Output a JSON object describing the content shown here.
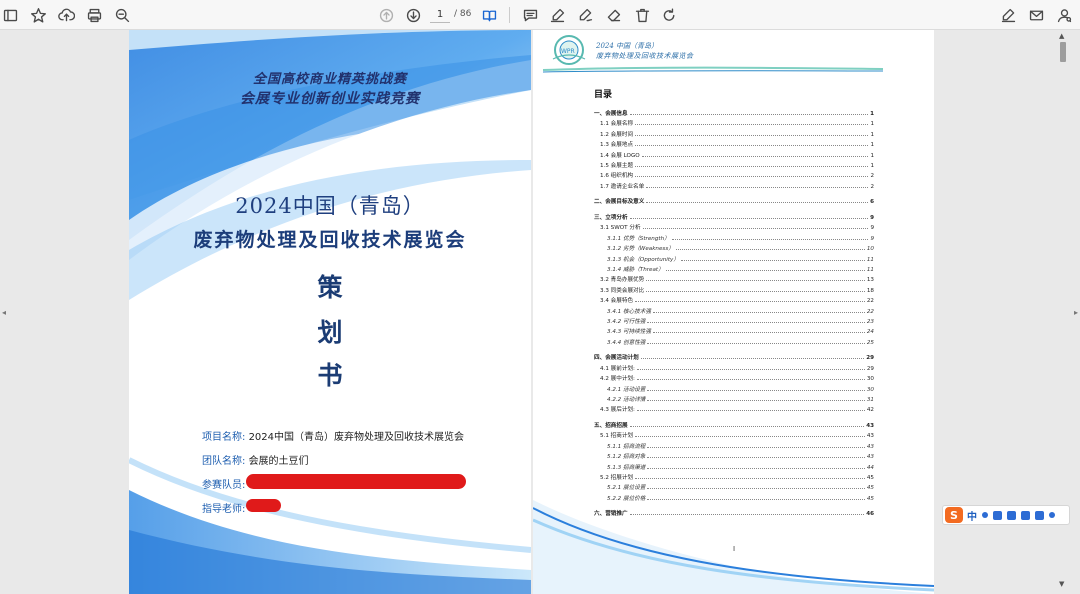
{
  "toolbar": {
    "current_page": "1",
    "total_pages": "/ 86"
  },
  "cover": {
    "header_line1": "全国高校商业精英挑战赛",
    "header_line2": "会展专业创新创业实践竞赛",
    "title_line1": "2024中国（青岛）",
    "title_line2": "废弃物处理及回收技术展览会",
    "big_chars": [
      "策",
      "划",
      "书"
    ],
    "fields": [
      {
        "label": "项目名称:",
        "value": "2024中国（青岛）废弃物处理及回收技术展览会"
      },
      {
        "label": "团队名称:",
        "value": "会展的土豆们"
      },
      {
        "label": "参赛队员:",
        "value": ""
      },
      {
        "label": "指导老师:",
        "value": ""
      }
    ],
    "colors": {
      "accent_blue": "#1f5fb0",
      "redaction": "#e01a1a"
    }
  },
  "toc": {
    "header_line1": "2024 中国（青岛）",
    "header_line2": "废弃物处理及回收技术展览会",
    "title": "目录",
    "entries": [
      {
        "level": 1,
        "text": "一、会展信息",
        "page": "1"
      },
      {
        "level": 2,
        "text": "1.1 会展名称",
        "page": "1"
      },
      {
        "level": 2,
        "text": "1.2 会展时间",
        "page": "1"
      },
      {
        "level": 2,
        "text": "1.3 会展地点",
        "page": "1"
      },
      {
        "level": 2,
        "text": "1.4 会展 LOGO",
        "page": "1"
      },
      {
        "level": 2,
        "text": "1.5 会展主题",
        "page": "1"
      },
      {
        "level": 2,
        "text": "1.6 组织机构",
        "page": "2"
      },
      {
        "level": 2,
        "text": "1.7 邀请企业名单",
        "page": "2"
      },
      {
        "level": 1,
        "text": "二、会展目标及意义",
        "page": "6"
      },
      {
        "level": 1,
        "text": "三、立项分析",
        "page": "9"
      },
      {
        "level": 2,
        "text": "3.1 SWOT 分析",
        "page": "9"
      },
      {
        "level": 3,
        "text": "3.1.1 优势（Strength）",
        "page": "9"
      },
      {
        "level": 3,
        "text": "3.1.2 劣势（Weakness）",
        "page": "10"
      },
      {
        "level": 3,
        "text": "3.1.3 机会（Opportunity）",
        "page": "11"
      },
      {
        "level": 3,
        "text": "3.1.4 威胁（Threat）",
        "page": "11"
      },
      {
        "level": 2,
        "text": "3.2 青岛办展优势",
        "page": "13"
      },
      {
        "level": 2,
        "text": "3.3 同类会展对比",
        "page": "18"
      },
      {
        "level": 2,
        "text": "3.4 会展特色",
        "page": "22"
      },
      {
        "level": 3,
        "text": "3.4.1 核心技术强",
        "page": "22"
      },
      {
        "level": 3,
        "text": "3.4.2 可行性强",
        "page": "23"
      },
      {
        "level": 3,
        "text": "3.4.3 可持续性强",
        "page": "24"
      },
      {
        "level": 3,
        "text": "3.4.4 创意性强",
        "page": "25"
      },
      {
        "level": 1,
        "text": "四、会展活动计划",
        "page": "29"
      },
      {
        "level": 2,
        "text": "4.1 展前计划:",
        "page": "29"
      },
      {
        "level": 2,
        "text": "4.2 展中计划:",
        "page": "30"
      },
      {
        "level": 3,
        "text": "4.2.1 活动设置",
        "page": "30"
      },
      {
        "level": 3,
        "text": "4.2.2 活动详情",
        "page": "31"
      },
      {
        "level": 2,
        "text": "4.3 展后计划:",
        "page": "42"
      },
      {
        "level": 1,
        "text": "五、招商招展",
        "page": "43"
      },
      {
        "level": 2,
        "text": "5.1 招商计划",
        "page": "43"
      },
      {
        "level": 3,
        "text": "5.1.1 招商流程",
        "page": "43"
      },
      {
        "level": 3,
        "text": "5.1.2 招商对象",
        "page": "43"
      },
      {
        "level": 3,
        "text": "5.1.3 招商渠道",
        "page": "44"
      },
      {
        "level": 2,
        "text": "5.2 招展计划",
        "page": "45"
      },
      {
        "level": 3,
        "text": "5.2.1 展位设置",
        "page": "45"
      },
      {
        "level": 3,
        "text": "5.2.2 展位价格",
        "page": "45"
      },
      {
        "level": 1,
        "text": "六、营销推广",
        "page": "46"
      }
    ],
    "page_number": "I"
  },
  "ime": {
    "logo": "S",
    "lang": "中"
  }
}
